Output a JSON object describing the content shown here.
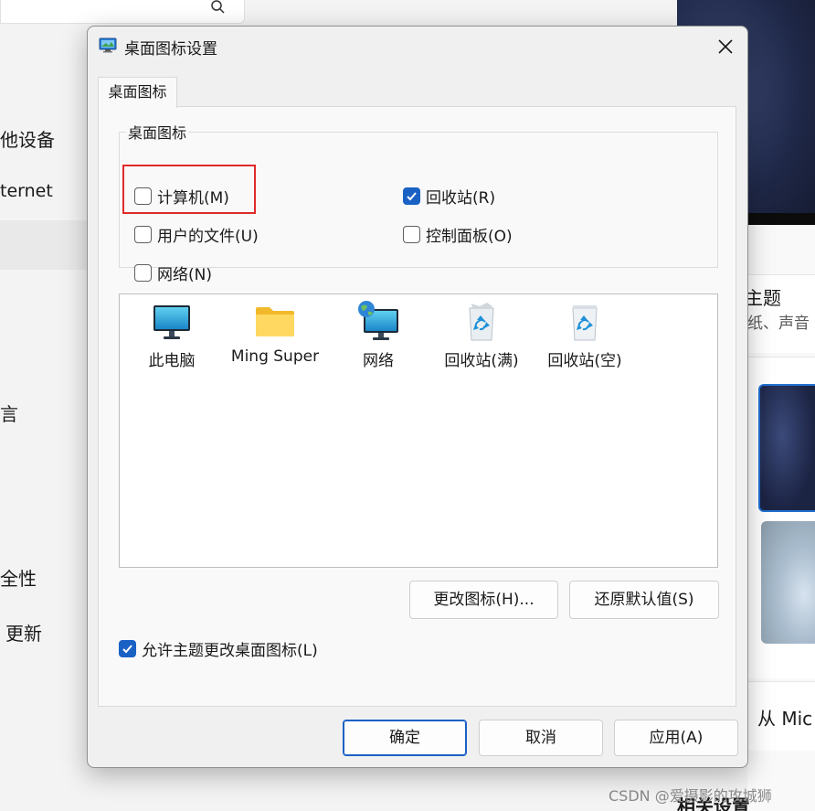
{
  "background": {
    "nav_items": [
      "他设备",
      "ternet",
      "言",
      "全性",
      "更新"
    ],
    "right_items": [
      "主题",
      "纸、声音",
      "从 Mic",
      "相关设置"
    ]
  },
  "dialog": {
    "title": "桌面图标设置",
    "tab_label": "桌面图标",
    "group_label": "桌面图标",
    "checkboxes": [
      {
        "label": "计算机(M)",
        "checked": false
      },
      {
        "label": "回收站(R)",
        "checked": true
      },
      {
        "label": "用户的文件(U)",
        "checked": false
      },
      {
        "label": "控制面板(O)",
        "checked": false
      },
      {
        "label": "网络(N)",
        "checked": false
      }
    ],
    "icons": [
      {
        "label": "此电脑",
        "icon": "monitor-icon"
      },
      {
        "label": "Ming Super",
        "icon": "folder-icon"
      },
      {
        "label": "网络",
        "icon": "network-globe-icon"
      },
      {
        "label": "回收站(满)",
        "icon": "recycle-bin-full-icon"
      },
      {
        "label": "回收站(空)",
        "icon": "recycle-bin-empty-icon"
      }
    ],
    "change_icon_label": "更改图标(H)...",
    "restore_default_label": "还原默认值(S)",
    "allow_themes": {
      "label": "允许主题更改桌面图标(L)",
      "checked": true
    },
    "ok_label": "确定",
    "cancel_label": "取消",
    "apply_label": "应用(A)"
  },
  "watermark": "CSDN @爱摄影的攻城狮",
  "colors": {
    "accent": "#1a61c4",
    "highlight": "#e02a2a"
  }
}
